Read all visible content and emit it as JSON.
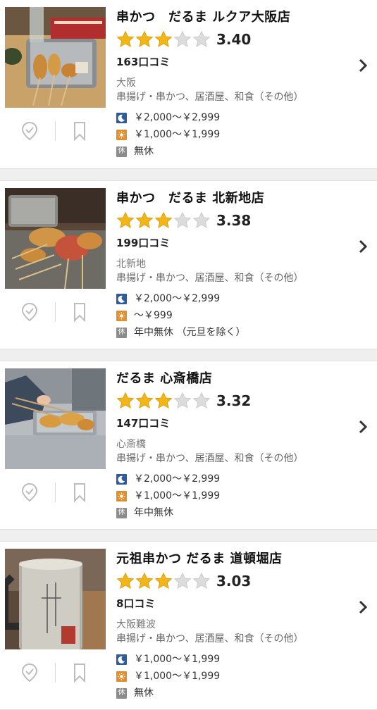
{
  "colors": {
    "star_on": "#f3b619",
    "star_off": "#dcdcdc",
    "night_badge": "#2f5d9c",
    "lunch_badge": "#e48d2b",
    "holiday_badge": "#8c8c8c"
  },
  "restaurants": [
    {
      "name": "串かつ　だるま ルクア大阪店",
      "rating_stars": 3,
      "score": "3.40",
      "reviews": "163口コミ",
      "area": "大阪",
      "genre": "串揚げ・串かつ、居酒屋、和食（その他）",
      "dinner_price": "￥2,000～￥2,999",
      "lunch_price": "￥1,000～￥1,999",
      "holiday": "無休",
      "photo_icon": "kushikatsu-tray-photo"
    },
    {
      "name": "串かつ　だるま 北新地店",
      "rating_stars": 3,
      "score": "3.38",
      "reviews": "199口コミ",
      "area": "北新地",
      "genre": "串揚げ・串かつ、居酒屋、和食（その他）",
      "dinner_price": "￥2,000～￥2,999",
      "lunch_price": "～￥999",
      "holiday": "年中無休 （元旦を除く）",
      "photo_icon": "kushikatsu-skewers-photo"
    },
    {
      "name": "だるま 心斎橋店",
      "rating_stars": 3,
      "score": "3.32",
      "reviews": "147口コミ",
      "area": "心斎橋",
      "genre": "串揚げ・串かつ、居酒屋、和食（その他）",
      "dinner_price": "￥2,000～￥2,999",
      "lunch_price": "￥1,000～￥1,999",
      "holiday": "年中無休",
      "photo_icon": "kushikatsu-frying-photo"
    },
    {
      "name": "元祖串かつ だるま 道頓堀店",
      "rating_stars": 3,
      "score": "3.03",
      "reviews": "8口コミ",
      "area": "大阪難波",
      "genre": "串揚げ・串かつ、居酒屋、和食（その他）",
      "dinner_price": "￥1,000～￥1,999",
      "lunch_price": "￥1,000～￥1,999",
      "holiday": "無休",
      "photo_icon": "beer-mug-photo"
    }
  ],
  "labels": {
    "holiday_badge": "休"
  }
}
